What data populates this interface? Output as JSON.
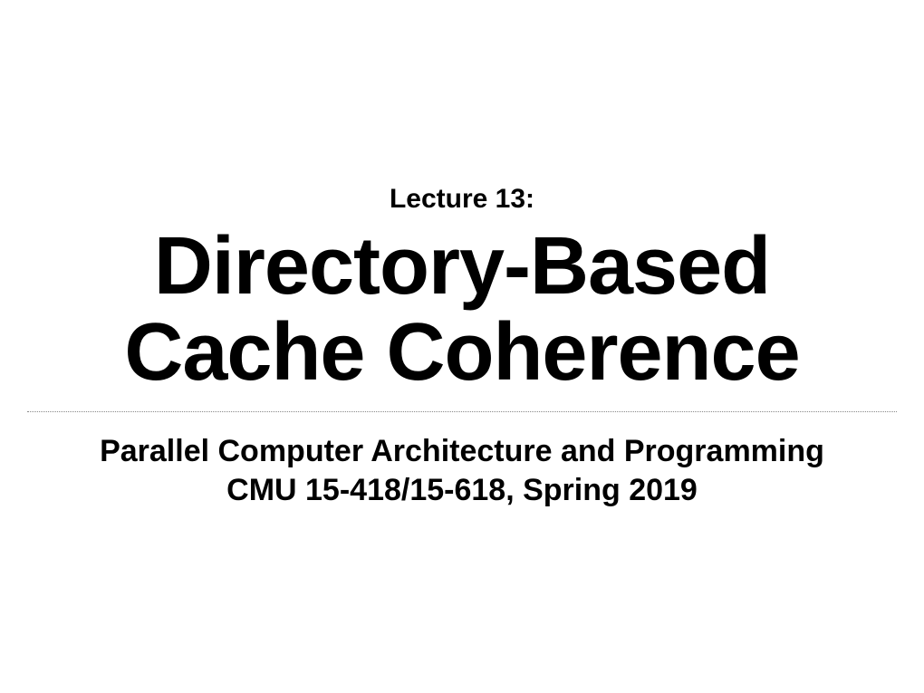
{
  "slide": {
    "lecture_label": "Lecture 13:",
    "title_line1": "Directory-Based",
    "title_line2": "Cache Coherence",
    "subtitle_line1": "Parallel Computer Architecture and Programming",
    "subtitle_line2": "CMU 15-418/15-618, Spring 2019"
  }
}
